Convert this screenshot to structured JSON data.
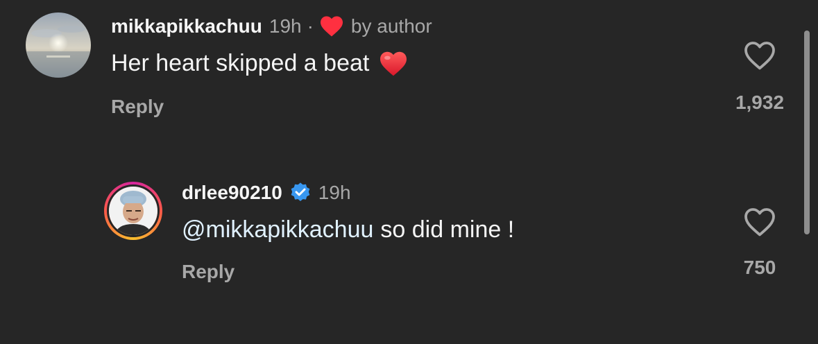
{
  "comments": [
    {
      "username": "mikkapikkachuu",
      "time": "19h",
      "separator": "·",
      "liked_by_author_label": "by author",
      "text": "Her heart skipped a beat",
      "emoji": "heart-emoji",
      "reply_label": "Reply",
      "like_count": "1,932",
      "avatar": "sunset-over-sea-photo"
    },
    {
      "username": "drlee90210",
      "verified": true,
      "time": "19h",
      "mention": "@mikkapikkachuu",
      "text": "so did mine !",
      "reply_label": "Reply",
      "like_count": "750",
      "avatar": "man-in-surgical-cap-photo"
    }
  ],
  "colors": {
    "background": "#262626",
    "primary_text": "#f5f5f5",
    "secondary_text": "#a8a8a8",
    "heart_red": "#ff3040",
    "verified_blue": "#3897f0",
    "mention": "#e0f1ff"
  }
}
